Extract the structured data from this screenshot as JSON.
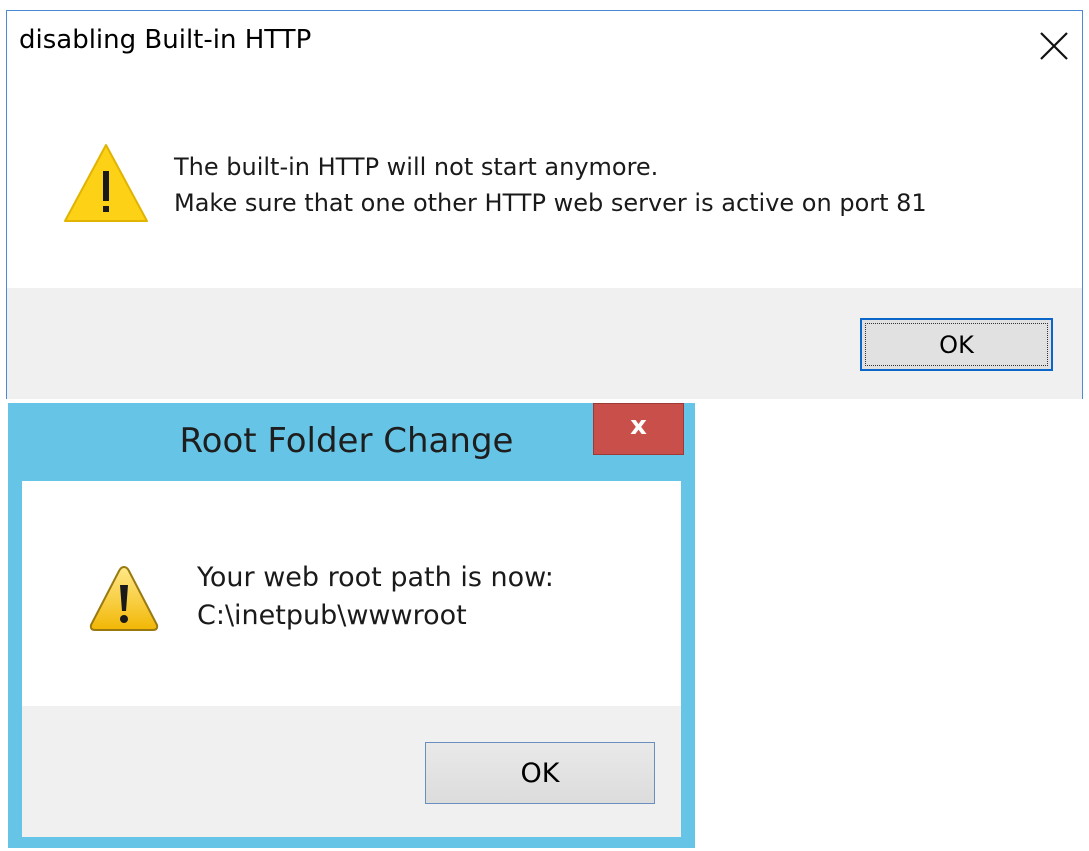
{
  "dialog1": {
    "title": "disabling Built-in HTTP",
    "icon": "warning-icon",
    "message_line1": "The built-in HTTP will not start anymore.",
    "message_line2": "Make sure that one other HTTP web server is active on port 81",
    "ok_label": "OK",
    "close_icon": "close-icon"
  },
  "dialog2": {
    "title": "Root Folder Change",
    "close_label": "x",
    "icon": "warning-icon",
    "message_line1": "Your web root path is now:",
    "message_line2": "C:\\inetpub\\wwwroot",
    "ok_label": "OK"
  },
  "colors": {
    "dialog1_border": "#4a8ad6",
    "dialog1_ok_border": "#0a66c8",
    "dialog2_frame": "#66c5e6",
    "dialog2_close_bg": "#c9504a",
    "footer_bg": "#f0f0f0",
    "warning_yellow": "#fcd116"
  }
}
